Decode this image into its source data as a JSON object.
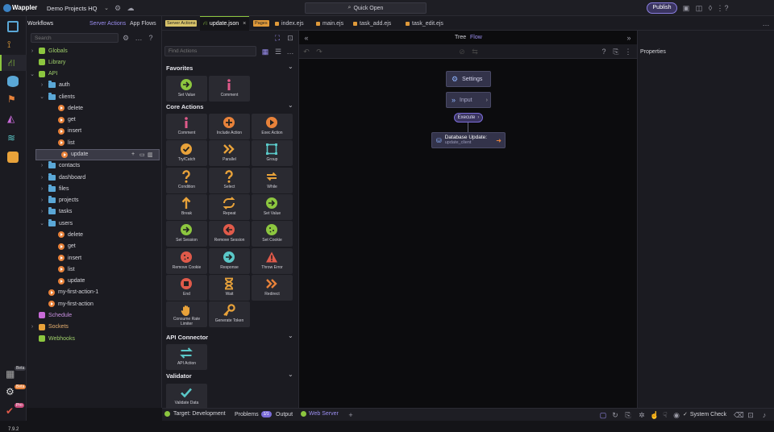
{
  "app": {
    "name": "Wappler",
    "project": "Demo Projects HQ",
    "quick_open": "Quick Open",
    "publish": "Publish",
    "version": "7.9.2"
  },
  "activity": {
    "badges": [
      "Beta",
      "Beta",
      "Pro"
    ]
  },
  "workflows": {
    "title": "Workflows",
    "tabs": [
      "Server Actions",
      "App Flows"
    ],
    "search_placeholder": "Search",
    "tree": [
      {
        "label": "Globals",
        "kind": "globals",
        "indent": 0,
        "chev": "›"
      },
      {
        "label": "Library",
        "kind": "library",
        "indent": 0,
        "chev": ""
      },
      {
        "label": "API",
        "kind": "api",
        "indent": 0,
        "chev": "⌄"
      },
      {
        "label": "auth",
        "kind": "folder",
        "indent": 1,
        "chev": "›"
      },
      {
        "label": "clients",
        "kind": "folder",
        "indent": 1,
        "chev": "⌄"
      },
      {
        "label": "delete",
        "kind": "action",
        "indent": 2,
        "chev": ""
      },
      {
        "label": "get",
        "kind": "action",
        "indent": 2,
        "chev": ""
      },
      {
        "label": "insert",
        "kind": "action",
        "indent": 2,
        "chev": ""
      },
      {
        "label": "list",
        "kind": "action",
        "indent": 2,
        "chev": ""
      },
      {
        "label": "update",
        "kind": "action",
        "indent": 2,
        "chev": "",
        "selected": true
      },
      {
        "label": "contacts",
        "kind": "folder",
        "indent": 1,
        "chev": "›"
      },
      {
        "label": "dashboard",
        "kind": "folder",
        "indent": 1,
        "chev": "›"
      },
      {
        "label": "files",
        "kind": "folder",
        "indent": 1,
        "chev": "›"
      },
      {
        "label": "projects",
        "kind": "folder",
        "indent": 1,
        "chev": "›"
      },
      {
        "label": "tasks",
        "kind": "folder",
        "indent": 1,
        "chev": "›"
      },
      {
        "label": "users",
        "kind": "folder",
        "indent": 1,
        "chev": "⌄"
      },
      {
        "label": "delete",
        "kind": "action",
        "indent": 2,
        "chev": ""
      },
      {
        "label": "get",
        "kind": "action",
        "indent": 2,
        "chev": ""
      },
      {
        "label": "insert",
        "kind": "action",
        "indent": 2,
        "chev": ""
      },
      {
        "label": "list",
        "kind": "action",
        "indent": 2,
        "chev": ""
      },
      {
        "label": "update",
        "kind": "action",
        "indent": 2,
        "chev": ""
      },
      {
        "label": "my-first-action-1",
        "kind": "action",
        "indent": 1,
        "chev": ""
      },
      {
        "label": "my-first-action",
        "kind": "action",
        "indent": 1,
        "chev": ""
      },
      {
        "label": "Schedule",
        "kind": "schedule",
        "indent": 0,
        "chev": ""
      },
      {
        "label": "Sockets",
        "kind": "sockets",
        "indent": 0,
        "chev": "›"
      },
      {
        "label": "Webhooks",
        "kind": "webhooks",
        "indent": 0,
        "chev": ""
      }
    ]
  },
  "tabs": {
    "group1_badge": "Server Actions",
    "active_file": "update.json",
    "group2_badge": "Pages",
    "files": [
      "index.ejs",
      "main.ejs",
      "task_add.ejs",
      "task_edit.ejs"
    ]
  },
  "actions": {
    "find_placeholder": "Find Actions",
    "sections": [
      {
        "title": "Favorites",
        "items": [
          {
            "label": "Set Value",
            "icon": "arrow-right-circle-icon",
            "color": "#8cc63f"
          },
          {
            "label": "Comment",
            "icon": "info-icon",
            "color": "#e05a8a"
          }
        ]
      },
      {
        "title": "Core Actions",
        "items": [
          {
            "label": "Comment",
            "icon": "info-icon",
            "color": "#e05a8a"
          },
          {
            "label": "Include Action",
            "icon": "plus-circle-icon",
            "color": "#e8823a"
          },
          {
            "label": "Exec Action",
            "icon": "play-circle-icon",
            "color": "#e8823a"
          },
          {
            "label": "Try/Catch",
            "icon": "check-circle-icon",
            "color": "#e8a23a"
          },
          {
            "label": "Parallel",
            "icon": "double-chevron-icon",
            "color": "#e8a23a"
          },
          {
            "label": "Group",
            "icon": "group-icon",
            "color": "#5ac8c8"
          },
          {
            "label": "Condition",
            "icon": "question-icon",
            "color": "#e8a23a"
          },
          {
            "label": "Select",
            "icon": "question-icon",
            "color": "#e8a23a"
          },
          {
            "label": "While",
            "icon": "loop-icon",
            "color": "#e8a23a"
          },
          {
            "label": "Break",
            "icon": "arrow-up-icon",
            "color": "#e8a23a"
          },
          {
            "label": "Repeat",
            "icon": "repeat-icon",
            "color": "#e8a23a"
          },
          {
            "label": "Set Value",
            "icon": "arrow-right-circle-icon",
            "color": "#8cc63f"
          },
          {
            "label": "Set Session",
            "icon": "arrow-right-circle-icon",
            "color": "#8cc63f"
          },
          {
            "label": "Remove Session",
            "icon": "arrow-left-circle-icon",
            "color": "#e05a4a"
          },
          {
            "label": "Set Cookie",
            "icon": "cookie-icon",
            "color": "#8cc63f"
          },
          {
            "label": "Remove Cookie",
            "icon": "cookie-icon",
            "color": "#e05a4a"
          },
          {
            "label": "Response",
            "icon": "arrow-right-circle-icon",
            "color": "#5ac8c8"
          },
          {
            "label": "Throw Error",
            "icon": "warning-icon",
            "color": "#e05a4a"
          },
          {
            "label": "End",
            "icon": "stop-circle-icon",
            "color": "#e05a4a"
          },
          {
            "label": "Wait",
            "icon": "hourglass-icon",
            "color": "#e8a23a"
          },
          {
            "label": "Redirect",
            "icon": "double-chevron-icon",
            "color": "#e8823a"
          },
          {
            "label": "Consume Rate Limiter",
            "icon": "hand-icon",
            "color": "#e8a23a"
          },
          {
            "label": "Generate Token",
            "icon": "key-icon",
            "color": "#e8a23a"
          }
        ]
      },
      {
        "title": "API Connector",
        "items": [
          {
            "label": "API Action",
            "icon": "exchange-icon",
            "color": "#5ac8c8"
          }
        ]
      },
      {
        "title": "Validator",
        "items": [
          {
            "label": "Validate Data",
            "icon": "checkmark-icon",
            "color": "#5ac8c8"
          }
        ]
      }
    ]
  },
  "canvas": {
    "view_tabs": [
      "Tree",
      "Flow"
    ],
    "nodes": {
      "settings": "Settings",
      "input": "Input",
      "execute": "Execute",
      "db_title": "Database Update:",
      "db_sub": "update_client"
    }
  },
  "properties": {
    "title": "Properties"
  },
  "status": {
    "target": "Target: Development",
    "problems": "Problems",
    "problems_count": "1/1",
    "output": "Output",
    "web_server": "Web Server",
    "system_check": "System Check"
  },
  "colors": {
    "accent": "#7b6cd9",
    "orange": "#e8823a",
    "folder": "#5aa7d6"
  }
}
